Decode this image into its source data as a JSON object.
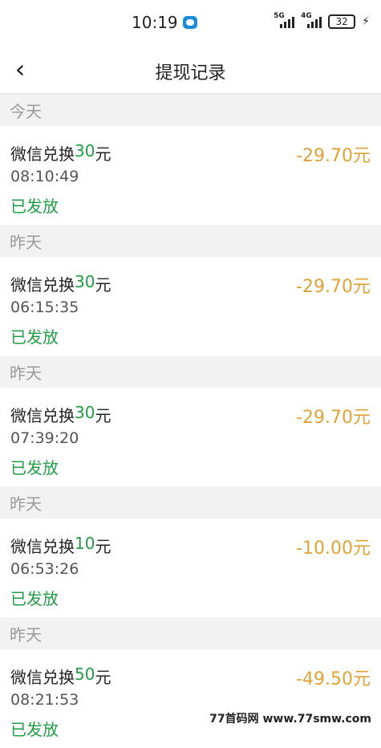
{
  "status_bar": {
    "time": "10:19",
    "network1": "5G",
    "network2": "4G",
    "battery": "32"
  },
  "header": {
    "title": "提现记录"
  },
  "sections": [
    {
      "label": "今天",
      "record": {
        "title_prefix": "微信兑换",
        "amount_num": "30",
        "unit": "元",
        "time": "08:10:49",
        "status": "已发放",
        "amount": "-29.70元"
      }
    },
    {
      "label": "昨天",
      "record": {
        "title_prefix": "微信兑换",
        "amount_num": "30",
        "unit": "元",
        "time": "06:15:35",
        "status": "已发放",
        "amount": "-29.70元"
      }
    },
    {
      "label": "昨天",
      "record": {
        "title_prefix": "微信兑换",
        "amount_num": "30",
        "unit": "元",
        "time": "07:39:20",
        "status": "已发放",
        "amount": "-29.70元"
      }
    },
    {
      "label": "昨天",
      "record": {
        "title_prefix": "微信兑换",
        "amount_num": "10",
        "unit": "元",
        "time": "06:53:26",
        "status": "已发放",
        "amount": "-10.00元"
      }
    },
    {
      "label": "昨天",
      "record": {
        "title_prefix": "微信兑换",
        "amount_num": "50",
        "unit": "元",
        "time": "08:21:53",
        "status": "已发放",
        "amount": "-49.50元"
      }
    }
  ],
  "watermark": "77首码网 www.77smw.com",
  "colors": {
    "accent_green": "#1e9e45",
    "amount_orange": "#e0a235",
    "section_bg": "#f2f2f2"
  }
}
